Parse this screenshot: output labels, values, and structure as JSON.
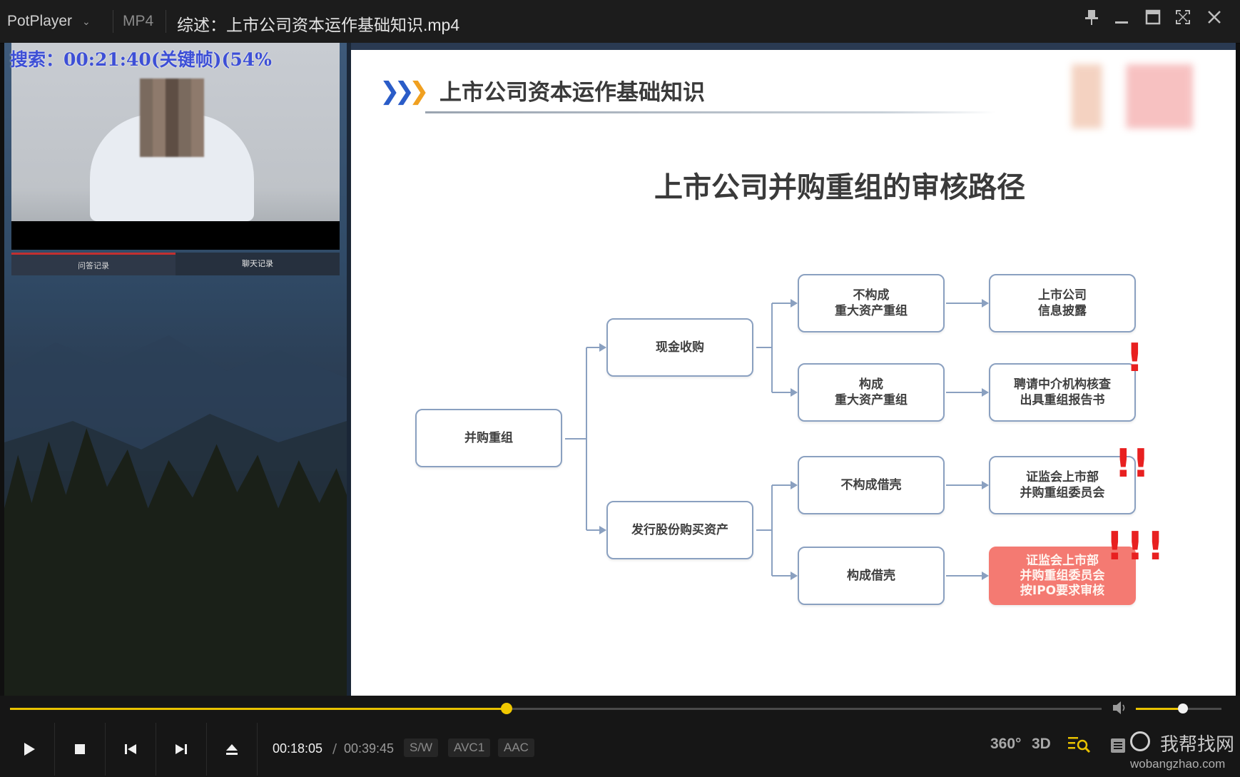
{
  "titlebar": {
    "app_name": "PotPlayer",
    "format": "MP4",
    "title": "综述：上市公司资本运作基础知识.mp4",
    "buttons": [
      "pin",
      "minimize",
      "maximize",
      "fullscreen",
      "close"
    ]
  },
  "video": {
    "search_overlay": "搜索：00:21:40(关键帧)(54%",
    "side_tabs": [
      "问答记录",
      "聊天记录"
    ],
    "slide": {
      "header": "上市公司资本运作基础知识",
      "title": "上市公司并购重组的审核路径",
      "nodes": {
        "root": "并购重组",
        "cash": "现金收购",
        "shares": "发行股份购买资产",
        "not_major_l1": "不构成",
        "not_major_l2": "重大资产重组",
        "major_l1": "构成",
        "major_l2": "重大资产重组",
        "not_backdoor": "不构成借壳",
        "backdoor": "构成借壳",
        "disclose_l1": "上市公司",
        "disclose_l2": "信息披露",
        "agency_l1": "聘请中介机构核查",
        "agency_l2": "出具重组报告书",
        "committee_l1": "证监会上市部",
        "committee_l2": "并购重组委员会",
        "ipo_l1": "证监会上市部",
        "ipo_l2": "并购重组委员会",
        "ipo_l3": "按IPO要求审核"
      },
      "marks": {
        "one": "!",
        "two": "!!",
        "three": "!!!"
      }
    }
  },
  "controls": {
    "progress_percent": 45.5,
    "volume_percent": 55,
    "current_time": "00:18:05",
    "separator": "/",
    "duration": "00:39:45",
    "badges": [
      "S/W",
      "AVC1",
      "AAC"
    ],
    "right_icons": [
      "360°",
      "3D"
    ],
    "watermark_cn": "我帮找网",
    "watermark_en": "wobangzhao.com"
  },
  "colors": {
    "accent": "#e8c200",
    "highlight_node": "#f47a72",
    "exclamation": "#e82020",
    "search_text": "#3d4fd6"
  }
}
